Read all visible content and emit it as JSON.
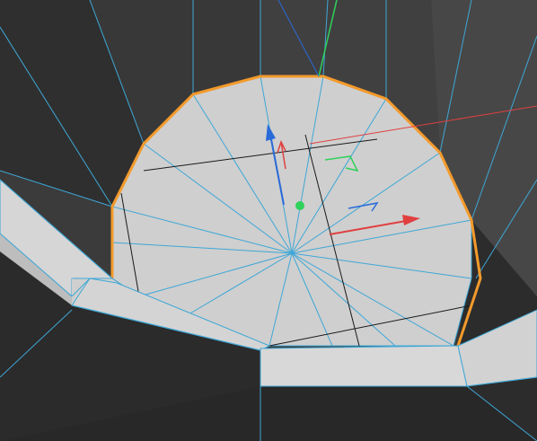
{
  "viewport": {
    "mode": "3d-viewport",
    "colors": {
      "background": "#3b3b3b",
      "wall_dark": "#2a2a2a",
      "wall_mid": "#4a4a4a",
      "cap_face": "#cfcfcf",
      "rim_face": "#d6d6d6",
      "wire": "#3ea7d6",
      "selection": "#f39a2b",
      "axis_x": "#e04040",
      "axis_y": "#2fd15a",
      "axis_z": "#2a6ad8"
    },
    "icons": [
      "move-gizmo-x-arrow-icon",
      "move-gizmo-y-handle-icon",
      "move-gizmo-z-arrow-icon",
      "rotate-gizmo-icon"
    ]
  }
}
